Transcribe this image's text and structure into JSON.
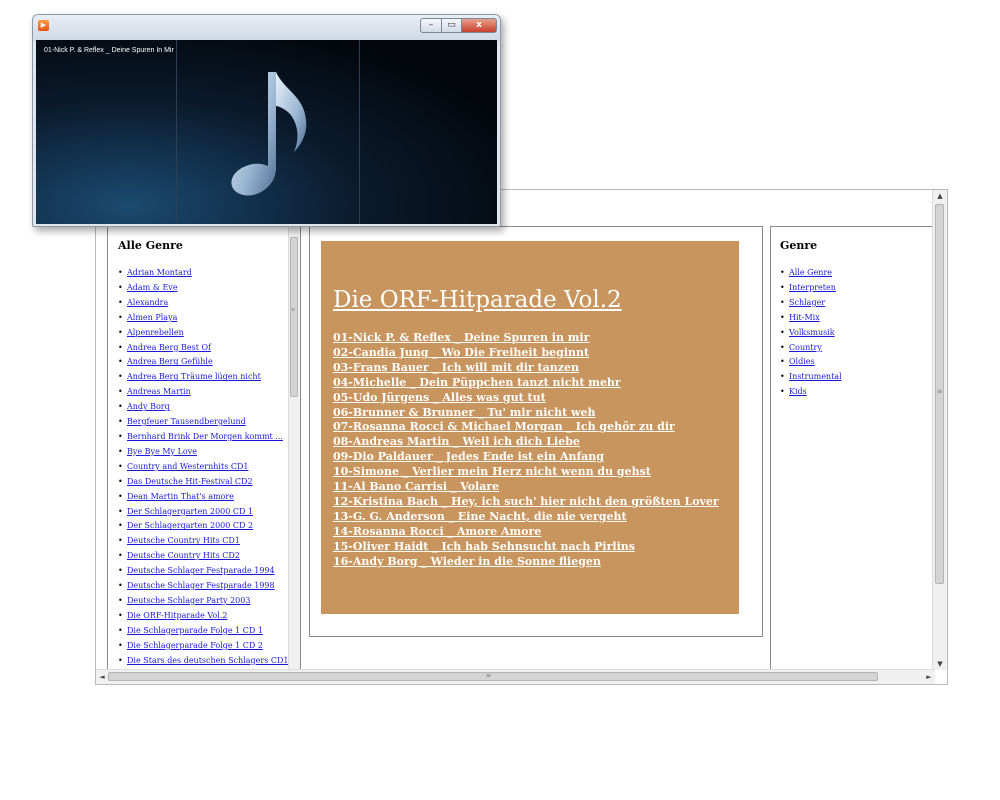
{
  "player": {
    "now_playing": "01-Nick P. & Reflex _ Deine Spuren In Mir",
    "app_icon": "media-player-icon",
    "min_label": "–",
    "max_label": "▭",
    "close_label": "x"
  },
  "left": {
    "heading": "Alle Genre",
    "items": [
      "Adrian Montard",
      "Adam & Eve",
      "Alexandra",
      "Almen Playa",
      "Alpenrebellen",
      "Andrea Berg Best Of",
      "Andrea Berg Gefühle",
      "Andrea Berg Träume lügen nicht",
      "Andreas Martin",
      "Andy Borg",
      "Bergfeuer Tausendbergelund",
      "Bernhard Brink Der Morgen kommt ...",
      "Bye Bye My Love",
      "Country and Westernhits CD1",
      "Das Deutsche Hit-Festival CD2",
      "Dean Martin That's amore",
      "Der Schlagergarten 2000 CD 1",
      "Der Schlagergarten 2000 CD 2",
      "Deutsche Country Hits CD1",
      "Deutsche Country Hits CD2",
      "Deutsche Schlager Festparade 1994",
      "Deutsche Schlager Festparade 1998",
      "Deutsche Schlager Party 2003",
      "Die ORF-Hitparade Vol.2",
      "Die Schlagerparade Folge 1 CD 1",
      "Die Schlagerparade Folge 1 CD 2",
      "Die Stars des deutschen Schlagers CD1"
    ]
  },
  "center": {
    "album_title": "Die ORF-Hitparade Vol.2",
    "tracks": [
      "01-Nick P. & Reflex _ Deine Spuren in mir",
      "02-Candia Jung _ Wo Die Freiheit beginnt",
      "03-Frans Bauer _ Ich will mit dir tanzen",
      "04-Michelle _ Dein Püppchen tanzt nicht mehr",
      "05-Udo Jürgens _ Alles was gut tut",
      "06-Brunner & Brunner _ Tu' mir nicht weh",
      "07-Rosanna Rocci & Michael Morgan _ Ich gehör zu dir",
      "08-Andreas Martin _ Weil ich dich Liebe",
      "09-Dio Paldauer _ Jedes Ende ist ein Anfang",
      "10-Simone _ Verlier mein Herz nicht wenn du gehst",
      "11-Al Bano Carrisi _ Volare",
      "12-Kristina Bach _ Hey, ich such' hier nicht den größten Lover",
      "13-G. G. Anderson _ Eine Nacht, die nie vergeht",
      "14-Rosanna Rocci _ Amore Amore",
      "15-Oliver Haidt _ Ich hab Sehnsucht nach Pirlins",
      "16-Andy Borg _ Wieder in die Sonne fliegen"
    ],
    "album_bg_color": "#c9955e"
  },
  "right": {
    "heading": "Genre",
    "items": [
      "Alle Genre",
      "Interpreten",
      "Schlager",
      "Hit-Mix",
      "Volksmusik",
      "Country",
      "Oldies",
      "Instrumental",
      "Kids"
    ]
  },
  "scroll_glyphs": {
    "up": "▲",
    "down": "▼",
    "left": "◄",
    "right": "►",
    "grip": "≡"
  }
}
